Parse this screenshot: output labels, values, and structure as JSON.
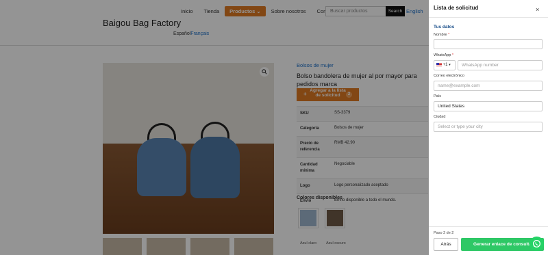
{
  "nav": {
    "items": [
      "Inicio",
      "Tienda",
      "Productos",
      "Sobre nosotros",
      "Contáctanos"
    ],
    "active_chevron": "⌄",
    "search_placeholder": "Buscar productos",
    "search_button": "Search",
    "lang_top": "English"
  },
  "header": {
    "brand": "Baigou Bag Factory",
    "lang_es": "Español",
    "lang_fr": "Français"
  },
  "product": {
    "category_crumb": "Bolsos de mujer",
    "title": "Bolso bandolera de mujer al por mayor para pedidos marca",
    "add_button": "Agregar a la lista de solicitud",
    "add_count": "2",
    "specs": [
      {
        "k": "SKU",
        "v": "SS-3379"
      },
      {
        "k": "Categoría",
        "v": "Bolsos de mujer"
      },
      {
        "k": "Precio de referencia",
        "v": "RMB 42.90"
      },
      {
        "k": "Cantidad mínima",
        "v": "Negociable"
      },
      {
        "k": "Logo",
        "v": "Logo personalizado aceptado"
      },
      {
        "k": "Envío",
        "v": "Envío disponible a todo el mundo."
      }
    ],
    "colors_title": "Colores disponibles",
    "colors": [
      "Azul claro",
      "Azul oscuro"
    ],
    "zoom_icon": "magnifier-icon"
  },
  "drawer": {
    "title": "Lista de solicitud",
    "close": "×",
    "section": "Tus datos",
    "name_label": "Nombre",
    "whatsapp_label": "WhatsApp",
    "required_mark": "*",
    "country_code": "+1",
    "whatsapp_placeholder": "WhatsApp number",
    "email_label": "Correo electrónico",
    "email_placeholder": "name@example.com",
    "country_label": "País",
    "country_value": "United States",
    "city_label": "Ciudad",
    "city_placeholder": "Select or type your city",
    "step": "Paso 2 de 2",
    "back": "Atrás",
    "generate": "Generar enlace de consulta"
  },
  "colors": {
    "accent": "#e07b24",
    "link": "#1a6fc9",
    "whatsapp": "#25d366"
  }
}
